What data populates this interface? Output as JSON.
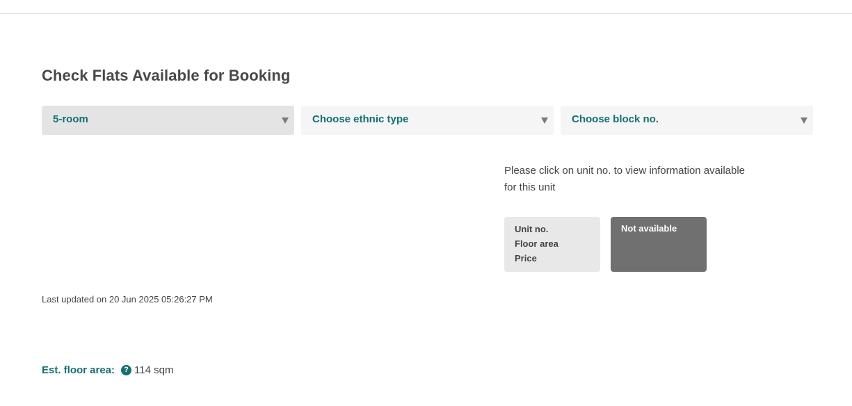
{
  "page_title": "Check Flats Available for Booking",
  "filters": [
    {
      "label": "5-room",
      "selected": true
    },
    {
      "label": "Choose ethnic type",
      "selected": false
    },
    {
      "label": "Choose block no.",
      "selected": false
    }
  ],
  "instructions": "Please click on unit no. to view information available for this unit",
  "legend": {
    "info_lines": [
      "Unit no.",
      "Floor area",
      "Price"
    ],
    "not_available": "Not available"
  },
  "last_updated": "Last updated on 20 Jun 2025 05:26:27 PM",
  "floor_area": {
    "label": "Est. floor area:",
    "help_icon": "?",
    "value": "114 sqm"
  },
  "colors": {
    "accent": "#0e7272",
    "not_available": "#707070",
    "legend_info_bg": "#e8e8e8"
  }
}
